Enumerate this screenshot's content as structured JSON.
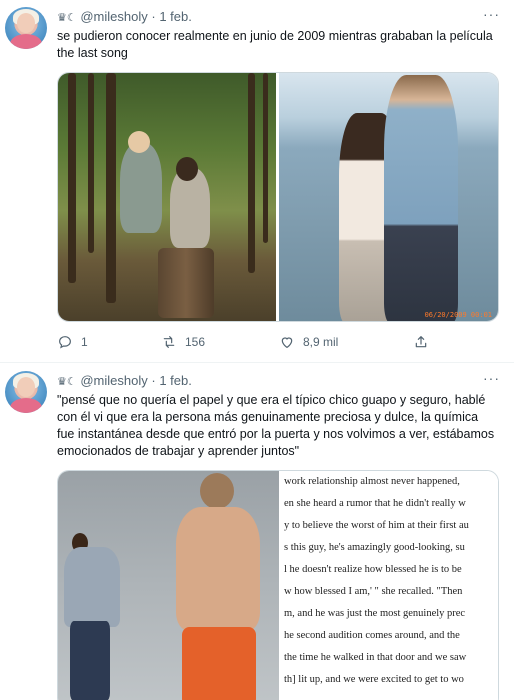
{
  "tweets": [
    {
      "display_name": "♛☾",
      "handle": "@milesholy",
      "separator": "·",
      "date": "1 feb.",
      "more": "···",
      "text": "se pudieron conocer realmente en junio de 2009 mientras grababan la película the last song",
      "photo_stamp": "06/20/2009 00:01",
      "reply_count": "1",
      "retweet_count": "156",
      "like_count": "8,9 mil"
    },
    {
      "display_name": "♛☾",
      "handle": "@milesholy",
      "separator": "·",
      "date": "1 feb.",
      "more": "···",
      "text": "\"pensé que no quería el papel y que era el típico chico guapo y seguro, hablé con él vi que era la persona más genuinamente preciosa y dulce, la química fue instantánea desde que entró por la puerta y nos volvimos a ver, estábamos emocionados de trabajar y aprender juntos\"",
      "article_lines": [
        "work relationship almost never happened,",
        "en she heard a rumor that he didn't really w",
        "y to believe the worst of him at their first au",
        "s this guy, he's amazingly good-looking, su",
        "l he doesn't realize how blessed he is to be",
        "w how blessed I am,' \" she recalled. \"Then",
        "m, and he was just the most genuinely prec",
        "he second audition comes around, and the",
        "the time he walked in that door and we saw",
        "th] lit up, and we were excited to get to wo"
      ]
    }
  ]
}
